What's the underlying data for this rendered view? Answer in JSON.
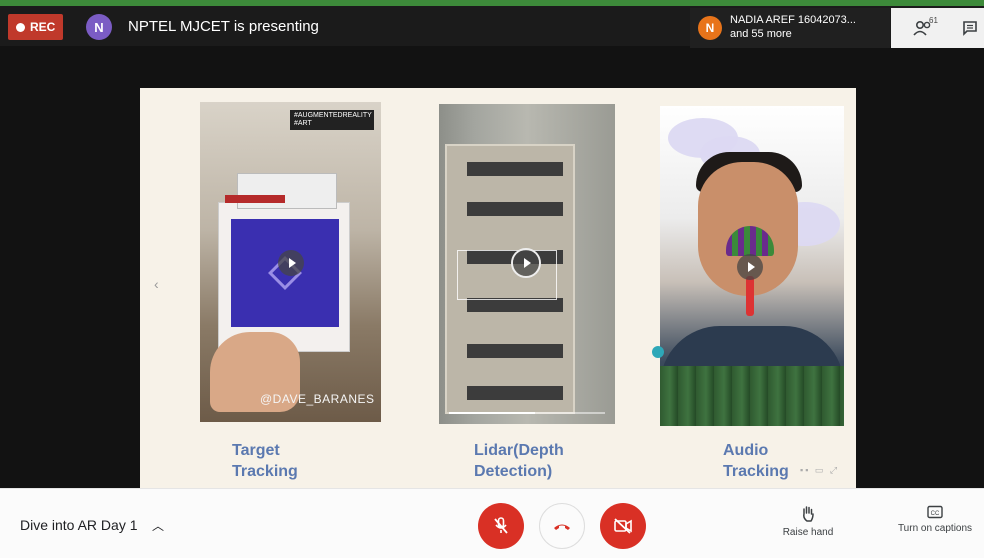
{
  "recording": {
    "label": "REC"
  },
  "presenter": {
    "initial": "N",
    "text": "NPTEL MJCET is presenting"
  },
  "participants": {
    "initial": "N",
    "name": "NADIA AREF 16042073...",
    "more": "and 55 more",
    "count": "61"
  },
  "slide": {
    "panels": [
      {
        "title_line1": "Target",
        "title_line2": "Tracking",
        "hashtag": "#AUGMENTEDREALITY #ART",
        "credit": "@DAVE_BARANES",
        "poster_name": "DAVE BARANES"
      },
      {
        "title_line1": "Lidar(Depth",
        "title_line2": "Detection)",
        "progress": 0.55
      },
      {
        "title_line1": "Audio",
        "title_line2": "Tracking"
      }
    ],
    "prev_arrow": "‹",
    "next_arrow": "›"
  },
  "bottom": {
    "meeting_title": "Dive into AR Day 1",
    "raise_hand": "Raise hand",
    "captions": "Turn on captions"
  },
  "colors": {
    "accent_red": "#d93025",
    "caption_blue": "#5b79b0",
    "rec_red": "#c0392b"
  },
  "icons": [
    "mic-off-icon",
    "hangup-icon",
    "camera-off-icon",
    "raise-hand-icon",
    "captions-icon",
    "people-icon",
    "chat-icon",
    "chevron-up-icon",
    "play-icon"
  ]
}
